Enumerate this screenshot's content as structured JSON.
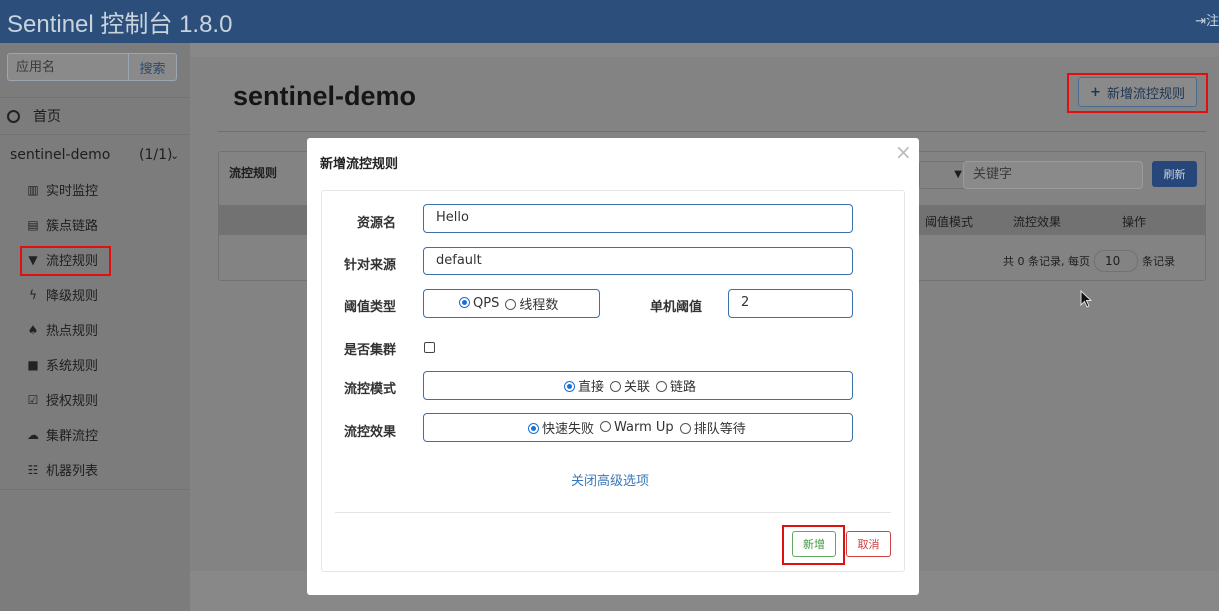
{
  "header": {
    "title": "Sentinel 控制台 1.8.0",
    "logout_label": "注"
  },
  "sidebar": {
    "search": {
      "placeholder": "应用名",
      "button_label": "搜索"
    },
    "home_label": "首页",
    "app": {
      "name": "sentinel-demo",
      "count": "(1/1)"
    },
    "items": [
      {
        "label": "实时监控",
        "icon": "bar-chart-icon"
      },
      {
        "label": "簇点链路",
        "icon": "list-icon"
      },
      {
        "label": "流控规则",
        "icon": "filter-icon"
      },
      {
        "label": "降级规则",
        "icon": "flash-icon"
      },
      {
        "label": "热点规则",
        "icon": "fire-icon"
      },
      {
        "label": "系统规则",
        "icon": "lock-icon"
      },
      {
        "label": "授权规则",
        "icon": "check-circle-icon"
      },
      {
        "label": "集群流控",
        "icon": "cloud-icon"
      },
      {
        "label": "机器列表",
        "icon": "grid-list-icon"
      }
    ]
  },
  "main": {
    "title": "sentinel-demo",
    "add_rule_label": "新增流控规则",
    "panel": {
      "title": "流控规则",
      "keyword_placeholder": "关键字",
      "refresh_label": "刷新",
      "columns": [
        "阈值模式",
        "流控效果",
        "操作"
      ],
      "pager": {
        "prefix": "共 0 条记录, 每页",
        "page_size": "10",
        "suffix": "条记录"
      }
    }
  },
  "modal": {
    "title": "新增流控规则",
    "close_label": "×",
    "fields": {
      "resource": {
        "label": "资源名",
        "value": "Hello"
      },
      "origin": {
        "label": "针对来源",
        "value": "default"
      },
      "threshold_type": {
        "label": "阈值类型",
        "options": [
          "QPS",
          "线程数"
        ],
        "selected": "QPS"
      },
      "threshold": {
        "label": "单机阈值",
        "value": "2"
      },
      "cluster": {
        "label": "是否集群",
        "checked": false
      },
      "mode": {
        "label": "流控模式",
        "options": [
          "直接",
          "关联",
          "链路"
        ],
        "selected": "直接"
      },
      "effect": {
        "label": "流控效果",
        "options": [
          "快速失败",
          "Warm Up",
          "排队等待"
        ],
        "selected": "快速失败"
      }
    },
    "advanced_link": "关闭高级选项",
    "confirm_label": "新增",
    "cancel_label": "取消"
  },
  "colors": {
    "header_bg": "#2b4e7a",
    "highlight_box": "#e01010",
    "link": "#3a78b8"
  }
}
